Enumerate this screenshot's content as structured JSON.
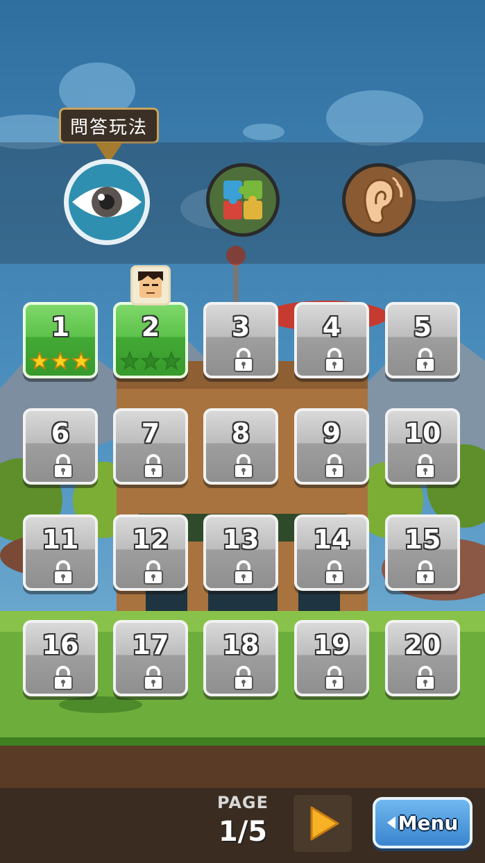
{
  "mode_tooltip": "問答玩法",
  "modes": [
    {
      "name": "eye-mode",
      "icon": "eye-icon",
      "selected": true
    },
    {
      "name": "puzzle-mode",
      "icon": "puzzle-icon",
      "selected": false
    },
    {
      "name": "ear-mode",
      "icon": "ear-icon",
      "selected": false
    }
  ],
  "levels": [
    {
      "label": "1",
      "state": "open",
      "stars_earned": 3
    },
    {
      "label": "2",
      "state": "open",
      "stars_earned": 0,
      "current": true
    },
    {
      "label": "3",
      "state": "locked"
    },
    {
      "label": "4",
      "state": "locked"
    },
    {
      "label": "5",
      "state": "locked"
    },
    {
      "label": "6",
      "state": "locked"
    },
    {
      "label": "7",
      "state": "locked"
    },
    {
      "label": "8",
      "state": "locked"
    },
    {
      "label": "9",
      "state": "locked"
    },
    {
      "label": "10",
      "state": "locked"
    },
    {
      "label": "11",
      "state": "locked"
    },
    {
      "label": "12",
      "state": "locked"
    },
    {
      "label": "13",
      "state": "locked"
    },
    {
      "label": "14",
      "state": "locked"
    },
    {
      "label": "15",
      "state": "locked"
    },
    {
      "label": "16",
      "state": "locked"
    },
    {
      "label": "17",
      "state": "locked"
    },
    {
      "label": "18",
      "state": "locked"
    },
    {
      "label": "19",
      "state": "locked"
    },
    {
      "label": "20",
      "state": "locked"
    }
  ],
  "pagination": {
    "label": "PAGE",
    "value": "1/5"
  },
  "menu_button": {
    "label": "Menu"
  },
  "colors": {
    "open_level": "#5cc24a",
    "locked_level": "#9e9e9e",
    "star_gold": "#ffd21e",
    "menu_blue": "#3a84cf"
  }
}
